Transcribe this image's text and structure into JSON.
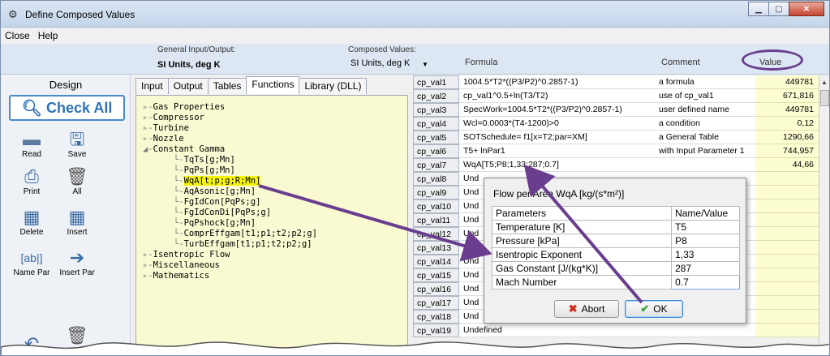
{
  "window": {
    "title": "Define Composed Values",
    "app_icon": "gear-icon",
    "controls": [
      "minimize-icon",
      "maximize-icon",
      "close-icon"
    ]
  },
  "menu": [
    "Close",
    "Help"
  ],
  "header": {
    "general_label": "General Input/Output:",
    "general_value": "SI Units, deg K",
    "composed_label": "Composed Values:",
    "composed_value": "SI Units, deg K",
    "col_formula": "Formula",
    "col_comment": "Comment",
    "col_value": "Value"
  },
  "left_panel": {
    "title": "Design",
    "check_all": "Check All",
    "tools": [
      {
        "label": "Read",
        "icon": "folder-icon"
      },
      {
        "label": "Save",
        "icon": "floppy-disk-icon"
      },
      {
        "label": "Print",
        "icon": "printer-icon"
      },
      {
        "label": "All",
        "icon": "trash-icon"
      },
      {
        "label": "Delete",
        "icon": "delete-row-icon"
      },
      {
        "label": "Insert",
        "icon": "insert-row-icon"
      },
      {
        "label": "Name Par",
        "icon": "text-field-icon"
      },
      {
        "label": "Insert Par",
        "icon": "arrow-right-icon"
      }
    ]
  },
  "tabs": [
    "Input",
    "Output",
    "Tables",
    "Functions",
    "Library (DLL)"
  ],
  "active_tab": "Functions",
  "tree": [
    {
      "text": "Gas Properties",
      "depth": 0,
      "expander": "▹"
    },
    {
      "text": "Compressor",
      "depth": 0,
      "expander": "▹"
    },
    {
      "text": "Turbine",
      "depth": 0,
      "expander": "▹"
    },
    {
      "text": "Nozzle",
      "depth": 0,
      "expander": "▹"
    },
    {
      "text": "Constant Gamma",
      "depth": 0,
      "expander": "◢"
    },
    {
      "text": "TqTs[g;Mn]",
      "depth": 1
    },
    {
      "text": "PqPs[g;Mn]",
      "depth": 1
    },
    {
      "text": "WqA[t;p;g;R;Mn]",
      "depth": 1,
      "highlight": true
    },
    {
      "text": "AqAsonic[g;Mn]",
      "depth": 1
    },
    {
      "text": "FgIdCon[PqPs;g]",
      "depth": 1
    },
    {
      "text": "FgIdConDi[PqPs;g]",
      "depth": 1
    },
    {
      "text": "PqPshock[g;Mn]",
      "depth": 1
    },
    {
      "text": "ComprEffgam[t1;p1;t2;p2;g]",
      "depth": 1
    },
    {
      "text": "TurbEffgam[t1;p1;t2;p2;g]",
      "depth": 1
    },
    {
      "text": "Isentropic Flow",
      "depth": 0,
      "expander": "▹"
    },
    {
      "text": "Miscellaneous",
      "depth": 0,
      "expander": "▹"
    },
    {
      "text": "Mathematics",
      "depth": 0,
      "expander": "▹"
    }
  ],
  "grid_rows": [
    {
      "name": "cp_val1",
      "formula": "1004.5*T2*((P3/P2)^0.2857-1)",
      "comment": "a formula",
      "value": "449781"
    },
    {
      "name": "cp_val2",
      "formula": "cp_val1^0.5+ln(T3/T2)",
      "comment": "use of cp_val1",
      "value": "671,816"
    },
    {
      "name": "cp_val3",
      "formula": "SpecWork=1004.5*T2*((P3/P2)^0.2857-1)",
      "comment": "user defined name",
      "value": "449781"
    },
    {
      "name": "cp_val4",
      "formula": "Wcl=0.0003*(T4-1200)>0",
      "comment": "a condition",
      "value": "0,12"
    },
    {
      "name": "cp_val5",
      "formula": "SOTSchedule= f1[x=T2;par=XM]",
      "comment": "a General Table",
      "value": "1290,66"
    },
    {
      "name": "cp_val6",
      "formula": "T5+ lnPar1",
      "comment": "with Input Parameter 1",
      "value": "744,957"
    },
    {
      "name": "cp_val7",
      "formula": "WqA[T5;P8;1,33;287;0.7]",
      "comment": "",
      "value": "44,66"
    },
    {
      "name": "cp_val8",
      "formula": "Und",
      "comment": "",
      "value": ""
    },
    {
      "name": "cp_val9",
      "formula": "Und",
      "comment": "",
      "value": ""
    },
    {
      "name": "cp_val10",
      "formula": "Und",
      "comment": "",
      "value": ""
    },
    {
      "name": "cp_val11",
      "formula": "Und",
      "comment": "",
      "value": ""
    },
    {
      "name": "cp_val12",
      "formula": "Und",
      "comment": "",
      "value": ""
    },
    {
      "name": "cp_val13",
      "formula": "Und",
      "comment": "",
      "value": ""
    },
    {
      "name": "cp_val14",
      "formula": "Und",
      "comment": "",
      "value": ""
    },
    {
      "name": "cp_val15",
      "formula": "Und",
      "comment": "",
      "value": ""
    },
    {
      "name": "cp_val16",
      "formula": "Und",
      "comment": "",
      "value": ""
    },
    {
      "name": "cp_val17",
      "formula": "Und",
      "comment": "",
      "value": ""
    },
    {
      "name": "cp_val18",
      "formula": "Und",
      "comment": "",
      "value": ""
    },
    {
      "name": "cp_val19",
      "formula": "Undefined",
      "comment": "",
      "value": ""
    }
  ],
  "popup": {
    "title": "Flow per Area WqA [kg/(s*m²)]",
    "col_params": "Parameters",
    "col_value": "Name/Value",
    "params": [
      {
        "name": "Temperature [K]",
        "value": "T5"
      },
      {
        "name": "Pressure [kPa]",
        "value": "P8"
      },
      {
        "name": "Isentropic Exponent",
        "value": "1,33"
      },
      {
        "name": "Gas Constant [J/(kg*K)]",
        "value": "287"
      },
      {
        "name": "Mach Number",
        "value": "0.7"
      }
    ],
    "abort_label": "Abort",
    "ok_label": "OK"
  },
  "colors": {
    "annotation": "#6a3e8e",
    "highlight": "#f4f40a",
    "tree_bg": "#fafad2",
    "value_bg": "#fdfdd2",
    "accent": "#2f72b8"
  }
}
